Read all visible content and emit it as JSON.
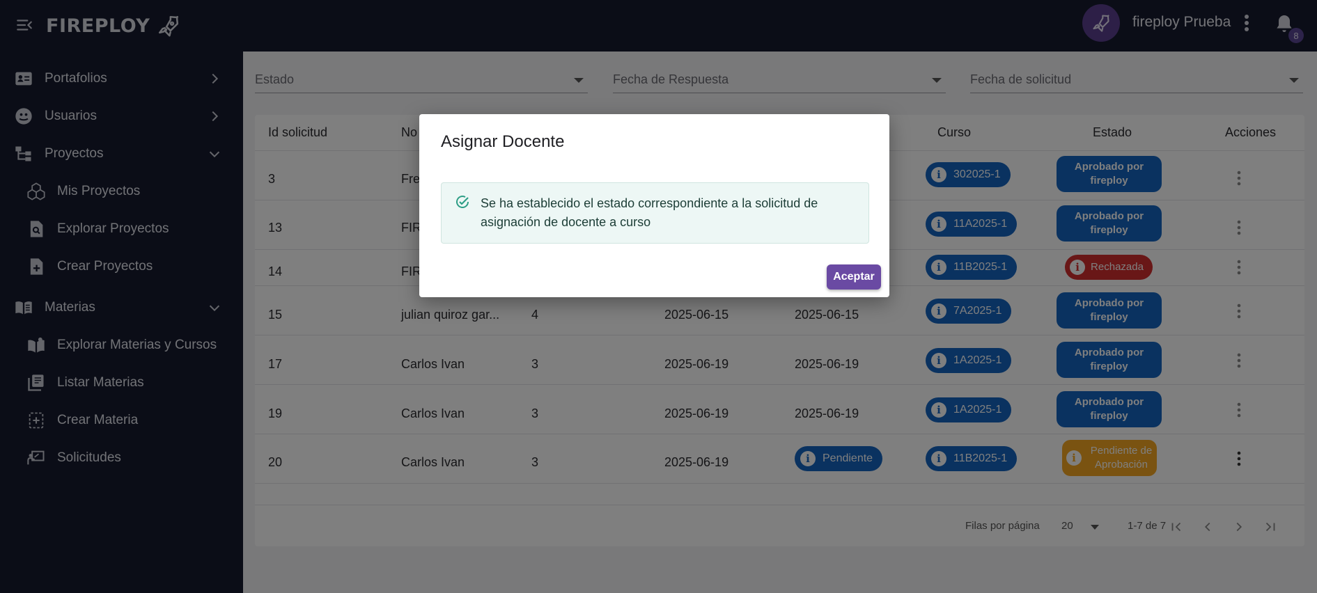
{
  "header": {
    "brand": "FIREPLOY",
    "user_name": "fireploy Prueba",
    "notification_count": "8"
  },
  "sidebar": {
    "items": [
      {
        "label": "Portafolios",
        "icon": "id-card-icon",
        "chevron": "chevron-right"
      },
      {
        "label": "Usuarios",
        "icon": "users-face-icon",
        "chevron": "chevron-right"
      },
      {
        "label": "Proyectos",
        "icon": "tree-structure-icon",
        "chevron": "chevron-down"
      },
      {
        "label": "Mis Proyectos",
        "icon": "cubes-icon"
      },
      {
        "label": "Explorar Proyectos",
        "icon": "file-search-icon"
      },
      {
        "label": "Crear Proyectos",
        "icon": "file-add-icon"
      },
      {
        "label": "Materias",
        "icon": "book-open-icon",
        "chevron": "chevron-down"
      },
      {
        "label": "Explorar Materias y Cursos",
        "icon": "book-reader-icon"
      },
      {
        "label": "Listar Materias",
        "icon": "library-books-icon"
      },
      {
        "label": "Crear Materia",
        "icon": "add-box-icon"
      },
      {
        "label": "Solicitudes",
        "icon": "teacher-board-icon"
      }
    ]
  },
  "filters": {
    "estado": "Estado",
    "fecha_respuesta": "Fecha de Respuesta",
    "fecha_solicitud": "Fecha de solicitud"
  },
  "table": {
    "headers": {
      "id": "Id solicitud",
      "nombre": "No",
      "curso": "Curso",
      "estado": "Estado",
      "acciones": "Acciones"
    },
    "rows": [
      {
        "id": "3",
        "nombre": "Fre",
        "num": "",
        "fecha1": "",
        "fecha2": "",
        "curso": "302025-1",
        "estado": "Aprobado por fireploy",
        "estado_type": "approved"
      },
      {
        "id": "13",
        "nombre": "FIR",
        "num": "",
        "fecha1": "",
        "fecha2": "",
        "curso": "11A2025-1",
        "estado": "Aprobado por fireploy",
        "estado_type": "approved"
      },
      {
        "id": "14",
        "nombre": "FIR",
        "num": "",
        "fecha1": "",
        "fecha2": "",
        "curso": "11B2025-1",
        "estado": "Rechazada",
        "estado_type": "rejected"
      },
      {
        "id": "15",
        "nombre": "julian quiroz gar...",
        "num": "4",
        "fecha1": "2025-06-15",
        "fecha2": "2025-06-15",
        "curso": "7A2025-1",
        "estado": "Aprobado por fireploy",
        "estado_type": "approved"
      },
      {
        "id": "17",
        "nombre": "Carlos Ivan",
        "num": "3",
        "fecha1": "2025-06-19",
        "fecha2": "2025-06-19",
        "curso": "1A2025-1",
        "estado": "Aprobado por fireploy",
        "estado_type": "approved"
      },
      {
        "id": "19",
        "nombre": "Carlos Ivan",
        "num": "3",
        "fecha1": "2025-06-19",
        "fecha2": "2025-06-19",
        "curso": "1A2025-1",
        "estado": "Aprobado por fireploy",
        "estado_type": "approved"
      },
      {
        "id": "20",
        "nombre": "Carlos Ivan",
        "num": "3",
        "fecha1": "2025-06-19",
        "fecha2_chip": "Pendiente",
        "curso": "11B2025-1",
        "estado": "Pendiente de Aprobación",
        "estado_type": "pending"
      }
    ]
  },
  "pagination": {
    "rows_per_page_label": "Filas por página",
    "rows_per_page_value": "20",
    "range": "1-7 de 7"
  },
  "dialog": {
    "title": "Asignar Docente",
    "message": "Se ha establecido el estado correspondiente a la solicitud de asignación de docente a curso",
    "accept_label": "Aceptar"
  },
  "colors": {
    "topbar": "#161a2e",
    "primary_chip": "#1565c0",
    "rejected": "#d32f2f",
    "pending": "#f5a623",
    "accept_button": "#6a4aa3"
  }
}
